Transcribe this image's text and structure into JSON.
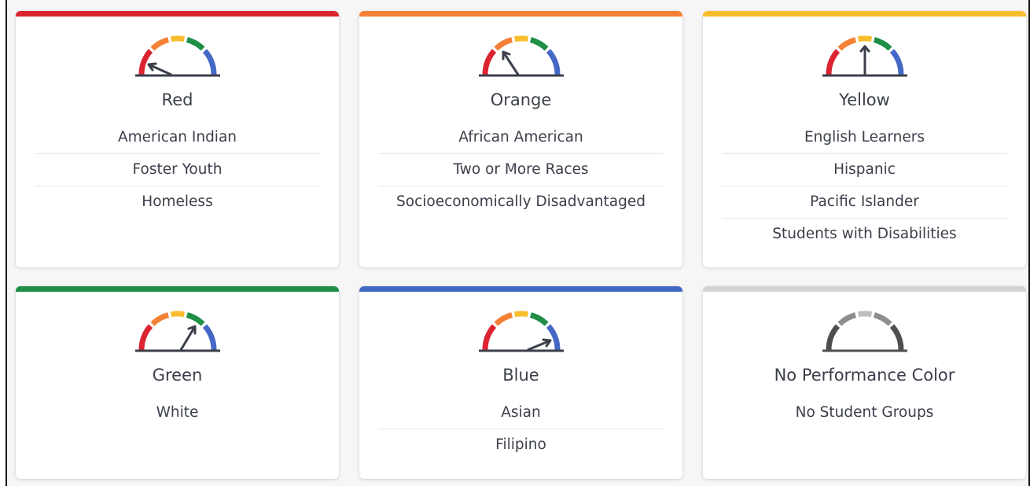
{
  "colors": {
    "red": "#dc2330",
    "orange": "#f58136",
    "yellow": "#f8bd2d",
    "green": "#1f8f46",
    "blue": "#4468c5",
    "gray": "#d3d3d3",
    "needle": "#3b3f4a",
    "gray_dark": "#4f4f4f",
    "gray_mid": "#8e8e8e",
    "gray_light": "#bdbdbd"
  },
  "cards": [
    {
      "title": "Red",
      "gauge": "performance-gauge-icon",
      "level": "red",
      "groups": [
        "American Indian",
        "Foster Youth",
        "Homeless"
      ]
    },
    {
      "title": "Orange",
      "gauge": "performance-gauge-icon",
      "level": "orange",
      "groups": [
        "African American",
        "Two or More Races",
        "Socioeconomically Disadvantaged"
      ]
    },
    {
      "title": "Yellow",
      "gauge": "performance-gauge-icon",
      "level": "yellow",
      "groups": [
        "English Learners",
        "Hispanic",
        "Pacific Islander",
        "Students with Disabilities"
      ]
    },
    {
      "title": "Green",
      "gauge": "performance-gauge-icon",
      "level": "green",
      "groups": [
        "White"
      ]
    },
    {
      "title": "Blue",
      "gauge": "performance-gauge-icon",
      "level": "blue",
      "groups": [
        "Asian",
        "Filipino"
      ]
    },
    {
      "title": "No Performance Color",
      "gauge": "no-color-gauge-icon",
      "level": "none",
      "groups": [
        "No Student Groups"
      ]
    }
  ]
}
